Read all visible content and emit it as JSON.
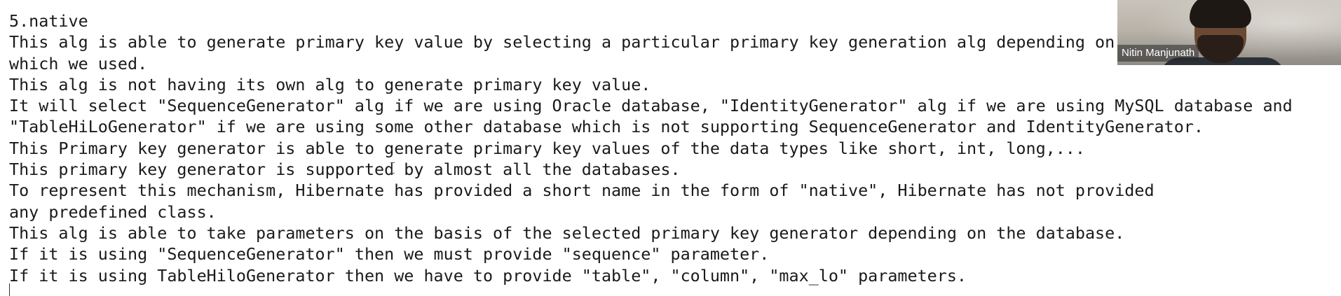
{
  "document": {
    "lines": [
      "5.native",
      "This alg is able to generate primary key value by selecting a particular primary key generation alg depending on",
      "which we used.",
      "This alg is not having its own alg to generate primary key value.",
      "It will select \"SequenceGenerator\" alg if we are using Oracle database, \"IdentityGenerator\" alg if we are using MySQL database and",
      "\"TableHiLoGenerator\" if we are using some other database which is not supporting SequenceGenerator and IdentityGenerator.",
      "This Primary key generator is able to generate primary key values of the data types like short, int, long,...",
      "This primary key generator is supported by almost all the databases.",
      "To represent this mechanism, Hibernate has provided a short name in the form of \"native\", Hibernate has not provided",
      "any predefined class.",
      "This alg is able to take parameters on the basis of the selected primary key generator depending on the database.",
      "If it is using \"SequenceGenerator\" then we must provide \"sequence\" parameter.",
      "If it is using TableHiloGenerator then we have to provide \"table\", \"column\", \"max_lo\" parameters."
    ]
  },
  "video_tile": {
    "participant_name": "Nitin Manjunath"
  },
  "colors": {
    "text": "#1a1a1a",
    "background": "#ffffff",
    "name_label_bg": "#282828"
  }
}
